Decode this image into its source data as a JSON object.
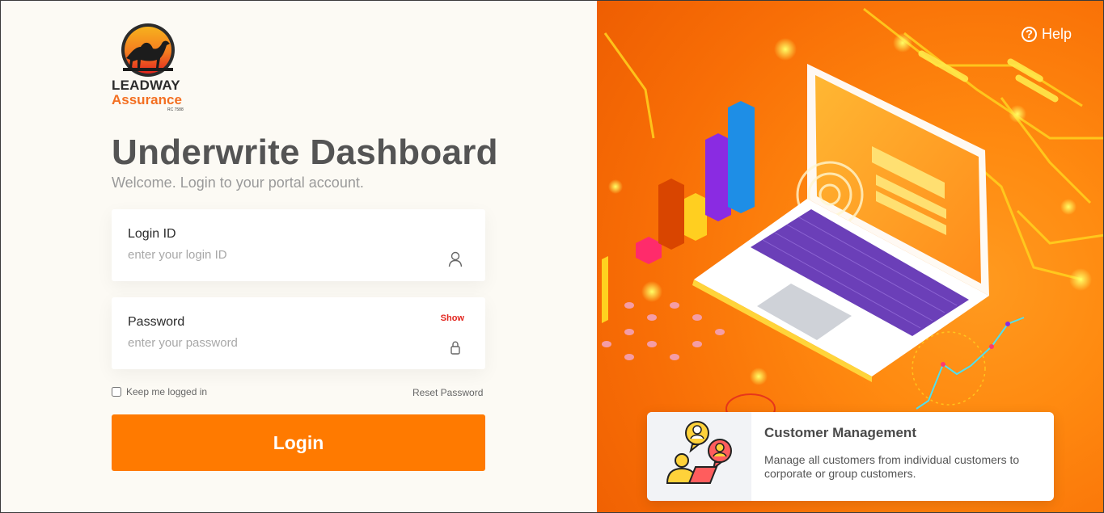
{
  "brand": {
    "line1": "LEADWAY",
    "line2": "Assurance",
    "rc": "RC 7588",
    "colors": {
      "orange": "#f36f21",
      "dark": "#2c2c2c"
    }
  },
  "header": {
    "title": "Underwrite Dashboard",
    "subtitle": "Welcome. Login to your portal account."
  },
  "form": {
    "login_id": {
      "label": "Login ID",
      "placeholder": "enter your login ID",
      "value": "",
      "icon": "user-icon"
    },
    "password": {
      "label": "Password",
      "placeholder": "enter your password",
      "value": "",
      "icon": "lock-icon",
      "show_label": "Show"
    },
    "keep_logged_in": {
      "label": "Keep me logged in",
      "checked": false
    },
    "reset_label": "Reset Password",
    "submit_label": "Login"
  },
  "help": {
    "label": "Help",
    "icon": "question-circle-icon"
  },
  "feature_card": {
    "icon": "customer-management-icon",
    "title": "Customer Management",
    "description": "Manage all customers from individual customers to corporate or group customers."
  },
  "theme": {
    "accent": "#ff7a00",
    "warning": "#e2261f",
    "panel_bg": "#fcfaf4"
  }
}
